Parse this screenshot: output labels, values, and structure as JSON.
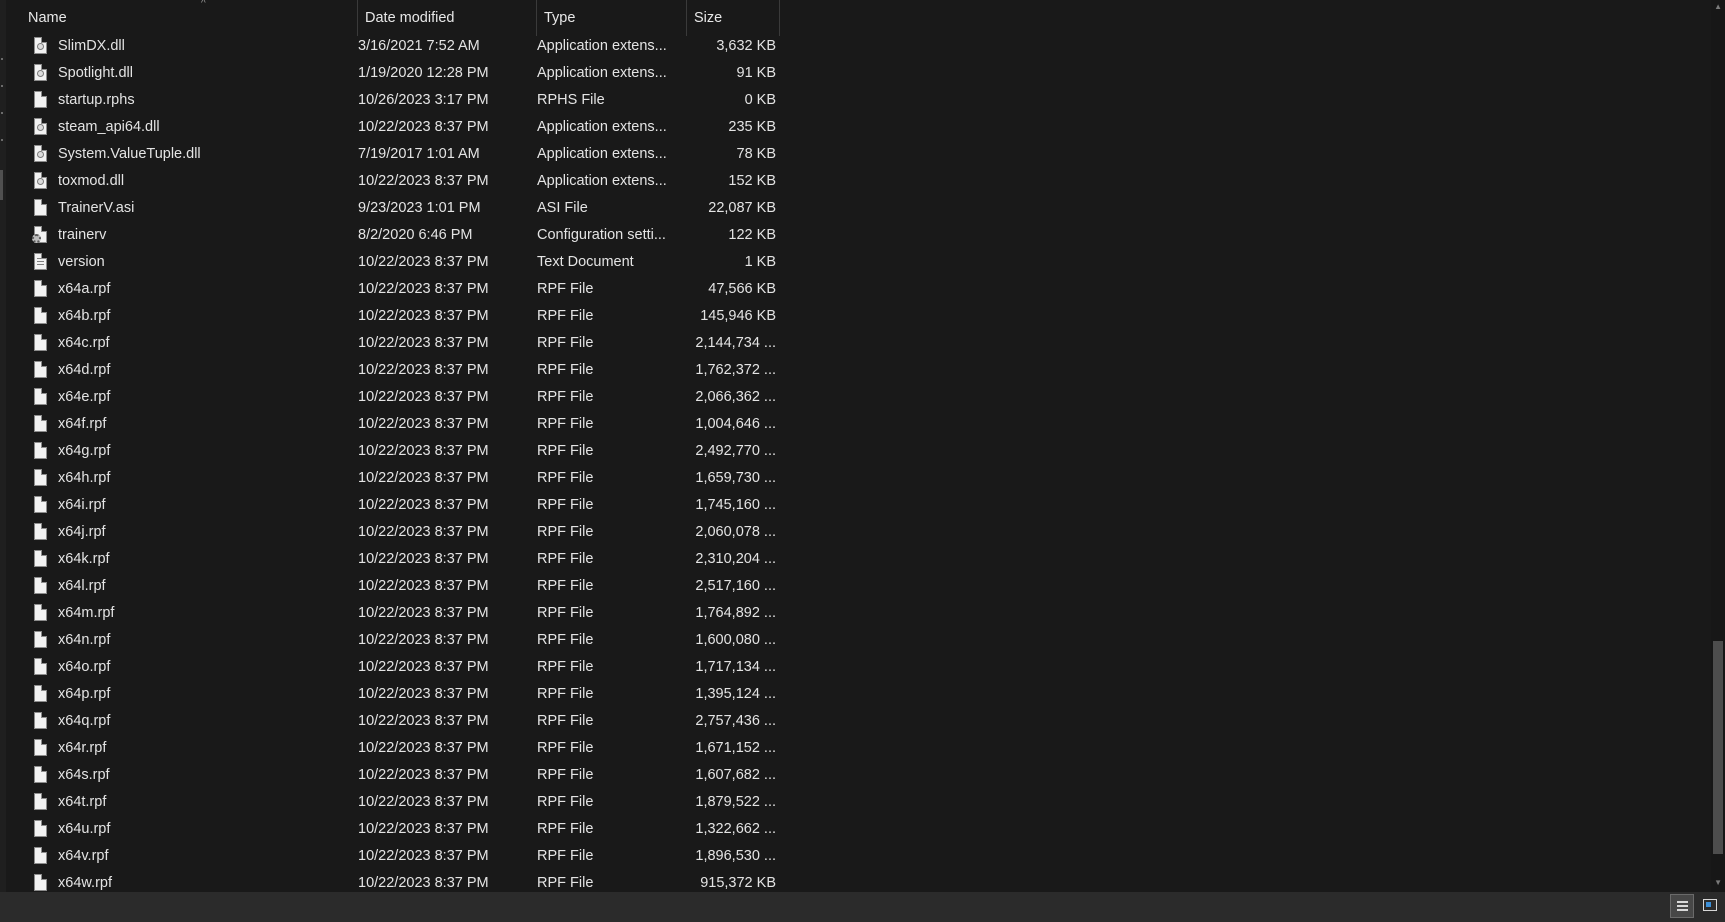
{
  "columns": {
    "name": "Name",
    "date": "Date modified",
    "type": "Type",
    "size": "Size"
  },
  "sort_indicator": "^",
  "files": [
    {
      "name": "SlimDX.dll",
      "date": "3/16/2021 7:52 AM",
      "type": "Application extens...",
      "size": "3,632 KB",
      "icon": "dll-file-icon"
    },
    {
      "name": "Spotlight.dll",
      "date": "1/19/2020 12:28 PM",
      "type": "Application extens...",
      "size": "91 KB",
      "icon": "dll-file-icon"
    },
    {
      "name": "startup.rphs",
      "date": "10/26/2023 3:17 PM",
      "type": "RPHS File",
      "size": "0 KB",
      "icon": "file-icon"
    },
    {
      "name": "steam_api64.dll",
      "date": "10/22/2023 8:37 PM",
      "type": "Application extens...",
      "size": "235 KB",
      "icon": "dll-file-icon"
    },
    {
      "name": "System.ValueTuple.dll",
      "date": "7/19/2017 1:01 AM",
      "type": "Application extens...",
      "size": "78 KB",
      "icon": "dll-file-icon"
    },
    {
      "name": "toxmod.dll",
      "date": "10/22/2023 8:37 PM",
      "type": "Application extens...",
      "size": "152 KB",
      "icon": "dll-file-icon"
    },
    {
      "name": "TrainerV.asi",
      "date": "9/23/2023 1:01 PM",
      "type": "ASI File",
      "size": "22,087 KB",
      "icon": "file-icon"
    },
    {
      "name": "trainerv",
      "date": "8/2/2020 6:46 PM",
      "type": "Configuration setti...",
      "size": "122 KB",
      "icon": "config-file-icon"
    },
    {
      "name": "version",
      "date": "10/22/2023 8:37 PM",
      "type": "Text Document",
      "size": "1 KB",
      "icon": "text-file-icon"
    },
    {
      "name": "x64a.rpf",
      "date": "10/22/2023 8:37 PM",
      "type": "RPF File",
      "size": "47,566 KB",
      "icon": "file-icon"
    },
    {
      "name": "x64b.rpf",
      "date": "10/22/2023 8:37 PM",
      "type": "RPF File",
      "size": "145,946 KB",
      "icon": "file-icon"
    },
    {
      "name": "x64c.rpf",
      "date": "10/22/2023 8:37 PM",
      "type": "RPF File",
      "size": "2,144,734 ...",
      "icon": "file-icon"
    },
    {
      "name": "x64d.rpf",
      "date": "10/22/2023 8:37 PM",
      "type": "RPF File",
      "size": "1,762,372 ...",
      "icon": "file-icon"
    },
    {
      "name": "x64e.rpf",
      "date": "10/22/2023 8:37 PM",
      "type": "RPF File",
      "size": "2,066,362 ...",
      "icon": "file-icon"
    },
    {
      "name": "x64f.rpf",
      "date": "10/22/2023 8:37 PM",
      "type": "RPF File",
      "size": "1,004,646 ...",
      "icon": "file-icon"
    },
    {
      "name": "x64g.rpf",
      "date": "10/22/2023 8:37 PM",
      "type": "RPF File",
      "size": "2,492,770 ...",
      "icon": "file-icon"
    },
    {
      "name": "x64h.rpf",
      "date": "10/22/2023 8:37 PM",
      "type": "RPF File",
      "size": "1,659,730 ...",
      "icon": "file-icon"
    },
    {
      "name": "x64i.rpf",
      "date": "10/22/2023 8:37 PM",
      "type": "RPF File",
      "size": "1,745,160 ...",
      "icon": "file-icon"
    },
    {
      "name": "x64j.rpf",
      "date": "10/22/2023 8:37 PM",
      "type": "RPF File",
      "size": "2,060,078 ...",
      "icon": "file-icon"
    },
    {
      "name": "x64k.rpf",
      "date": "10/22/2023 8:37 PM",
      "type": "RPF File",
      "size": "2,310,204 ...",
      "icon": "file-icon"
    },
    {
      "name": "x64l.rpf",
      "date": "10/22/2023 8:37 PM",
      "type": "RPF File",
      "size": "2,517,160 ...",
      "icon": "file-icon"
    },
    {
      "name": "x64m.rpf",
      "date": "10/22/2023 8:37 PM",
      "type": "RPF File",
      "size": "1,764,892 ...",
      "icon": "file-icon"
    },
    {
      "name": "x64n.rpf",
      "date": "10/22/2023 8:37 PM",
      "type": "RPF File",
      "size": "1,600,080 ...",
      "icon": "file-icon"
    },
    {
      "name": "x64o.rpf",
      "date": "10/22/2023 8:37 PM",
      "type": "RPF File",
      "size": "1,717,134 ...",
      "icon": "file-icon"
    },
    {
      "name": "x64p.rpf",
      "date": "10/22/2023 8:37 PM",
      "type": "RPF File",
      "size": "1,395,124 ...",
      "icon": "file-icon"
    },
    {
      "name": "x64q.rpf",
      "date": "10/22/2023 8:37 PM",
      "type": "RPF File",
      "size": "2,757,436 ...",
      "icon": "file-icon"
    },
    {
      "name": "x64r.rpf",
      "date": "10/22/2023 8:37 PM",
      "type": "RPF File",
      "size": "1,671,152 ...",
      "icon": "file-icon"
    },
    {
      "name": "x64s.rpf",
      "date": "10/22/2023 8:37 PM",
      "type": "RPF File",
      "size": "1,607,682 ...",
      "icon": "file-icon"
    },
    {
      "name": "x64t.rpf",
      "date": "10/22/2023 8:37 PM",
      "type": "RPF File",
      "size": "1,879,522 ...",
      "icon": "file-icon"
    },
    {
      "name": "x64u.rpf",
      "date": "10/22/2023 8:37 PM",
      "type": "RPF File",
      "size": "1,322,662 ...",
      "icon": "file-icon"
    },
    {
      "name": "x64v.rpf",
      "date": "10/22/2023 8:37 PM",
      "type": "RPF File",
      "size": "1,896,530 ...",
      "icon": "file-icon"
    },
    {
      "name": "x64w.rpf",
      "date": "10/22/2023 8:37 PM",
      "type": "RPF File",
      "size": "915,372 KB",
      "icon": "file-icon"
    }
  ],
  "statusbar": {
    "details_view_icon": "details-view-icon",
    "large_icons_view_icon": "large-icons-view-icon"
  },
  "colors": {
    "background": "#191919",
    "text": "#e6e6e6",
    "statusbar": "#2b2b2b",
    "scroll_thumb": "#4d4d4d"
  }
}
